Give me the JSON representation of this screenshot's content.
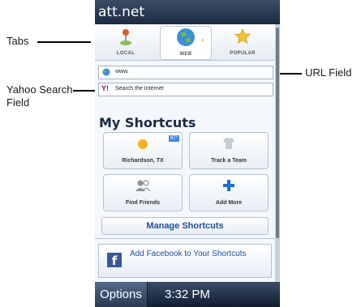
{
  "callouts": {
    "tabs": "Tabs",
    "yahoo_line1": "Yahoo Search",
    "yahoo_line2": "Field",
    "url": "URL Field"
  },
  "app": {
    "title": "att.net"
  },
  "tabs": [
    {
      "label": "LOCAL",
      "icon": "map-pin-icon"
    },
    {
      "label": "WEB",
      "icon": "globe-icon",
      "selected": true
    },
    {
      "label": "POPULAR",
      "icon": "star-icon"
    }
  ],
  "url_field": {
    "value": "www."
  },
  "search_field": {
    "placeholder": "Search the Internet",
    "icon": "yahoo-logo-icon"
  },
  "shortcuts": {
    "title": "My Shortcuts",
    "items": [
      {
        "label": "Richardson, TX",
        "icon": "weather-sun-icon",
        "badge": "97°"
      },
      {
        "label": "Track a Team",
        "icon": "jersey-icon"
      },
      {
        "label": "Find Friends",
        "icon": "people-icon"
      },
      {
        "label": "Add More",
        "icon": "plus-icon"
      }
    ],
    "manage_label": "Manage Shortcuts"
  },
  "facebook_banner": {
    "text": "Add Facebook to Your Shortcuts",
    "icon": "facebook-logo-icon",
    "logo_letter": "f"
  },
  "softkeys": {
    "options": "Options",
    "time": "3:32 PM"
  },
  "colors": {
    "accent": "#1f4fa0",
    "bar": "#1d2c43",
    "facebook": "#3b5998"
  }
}
